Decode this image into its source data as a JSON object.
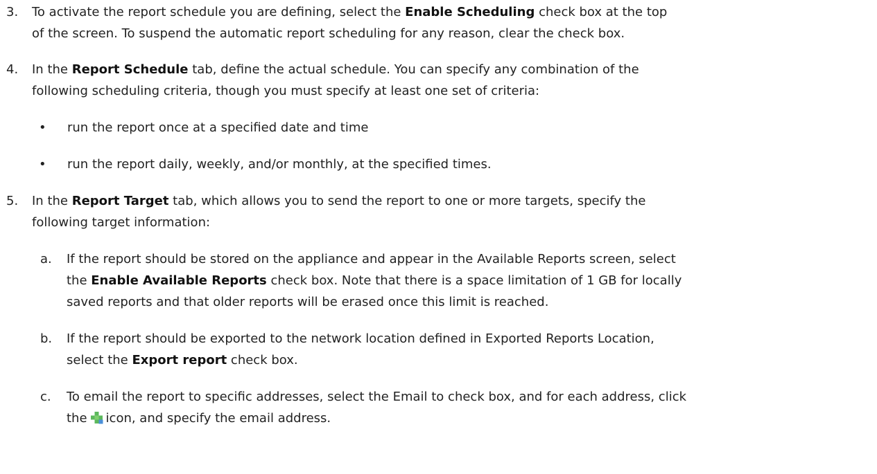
{
  "steps": [
    {
      "number": "3.",
      "line1": {
        "before": "To activate the report schedule you are defining, select the ",
        "bold": "Enable Scheduling",
        "after": " check box at the top"
      },
      "line2": "of the screen. To suspend the automatic report scheduling for any reason, clear the check box."
    },
    {
      "number": "4.",
      "line1": {
        "before": "In the ",
        "bold": "Report Schedule",
        "after": " tab, define the actual schedule. You can specify any combination of the"
      },
      "line2": "following scheduling criteria, though you must specify at least one set of criteria:",
      "bullets": [
        "run the report once at a specified date and time",
        "run the report daily, weekly, and/or monthly, at the specified times."
      ],
      "bullet_symbol": "•"
    },
    {
      "number": "5.",
      "line1": {
        "before": "In the ",
        "bold": "Report Target",
        "after": " tab, which allows you to send the report to one or more targets, specify the"
      },
      "line2": "following target information:",
      "substeps": [
        {
          "letter": "a.",
          "line1": "If the report should be stored on the appliance and appear in the Available Reports screen, select",
          "line2": {
            "before": "the ",
            "bold": "Enable Available Reports",
            "after": " check box. Note that there is a space limitation of 1 GB for locally"
          },
          "line3": "saved reports and that older reports will be erased once this limit is reached."
        },
        {
          "letter": "b.",
          "line1": "If the report should be exported to the network location defined in Exported Reports Location,",
          "line2": {
            "before": "select the ",
            "bold": "Export report",
            "after": " check box."
          }
        },
        {
          "letter": "c.",
          "line1": "To email the report to specific addresses, select the Email to check box, and for each address, click",
          "line2": {
            "before": "the",
            "after": "icon, and specify the email address."
          },
          "icon": "plus-icon"
        }
      ]
    }
  ],
  "colors": {
    "text": "#222222",
    "icon_green": "#5cb85c",
    "icon_blue": "#4a90d9"
  }
}
